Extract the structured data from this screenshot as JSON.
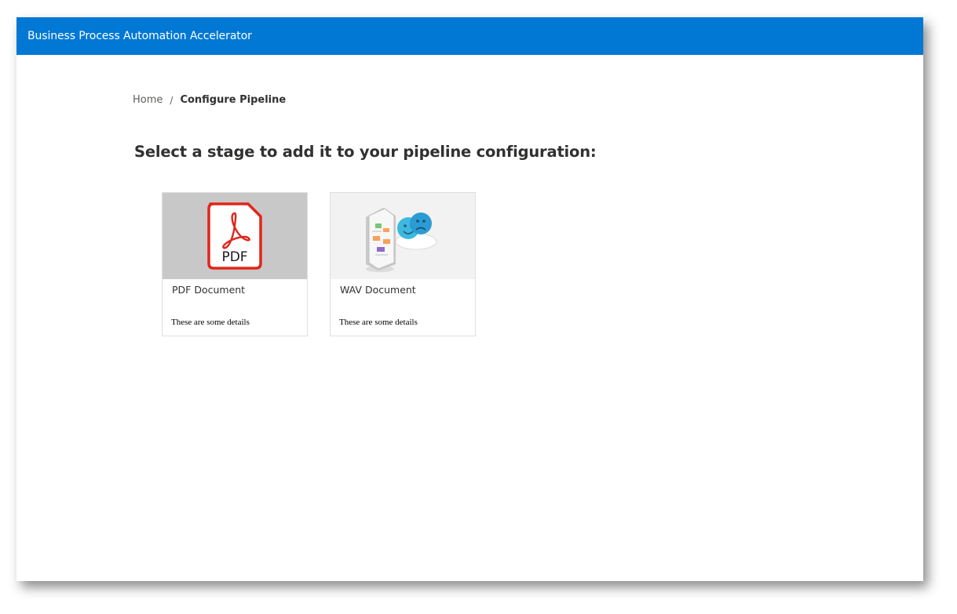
{
  "header": {
    "title": "Business Process Automation Accelerator"
  },
  "breadcrumb": {
    "home": "Home",
    "separator": "/",
    "current": "Configure Pipeline"
  },
  "main": {
    "heading": "Select a stage to add it to your pipeline configuration:",
    "cards": [
      {
        "title": "PDF Document",
        "details": "These are some details",
        "icon": "pdf-file-icon",
        "image_bg": "#c8c8c8"
      },
      {
        "title": "WAV Document",
        "details": "These are some details",
        "icon": "speech-analytics-icon",
        "image_bg": "#f2f2f2"
      }
    ]
  },
  "colors": {
    "accent": "#0078d4",
    "pdf_red": "#e1251b"
  },
  "icons": {
    "pdf_label": "PDF"
  }
}
